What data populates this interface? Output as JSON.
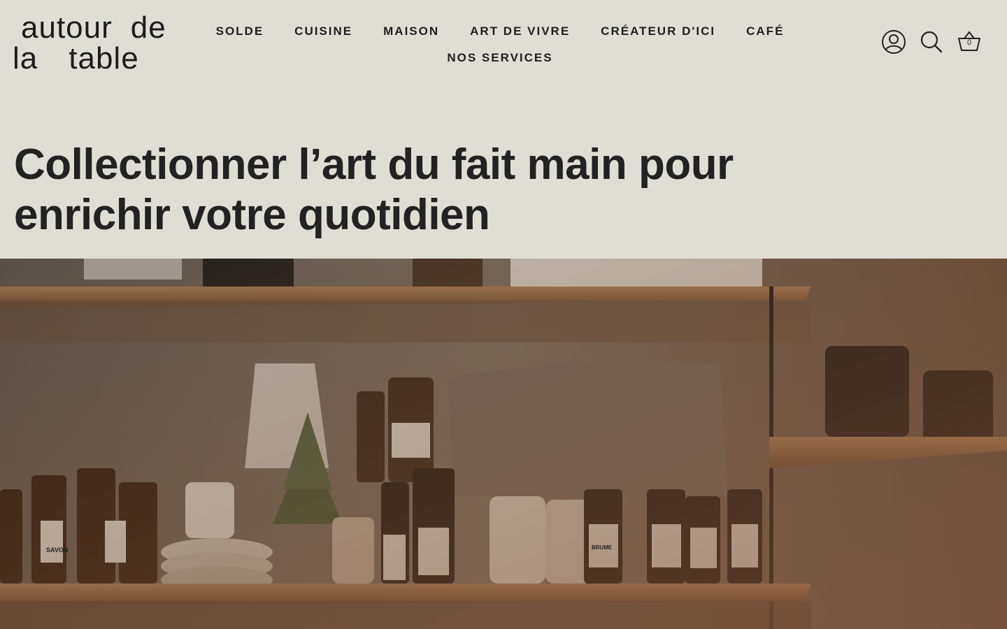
{
  "brand": {
    "line1_word1": "autour",
    "line1_word2": "de",
    "line2_word1": "la",
    "line2_word2": "table"
  },
  "nav": {
    "row1": [
      "SOLDE",
      "CUISINE",
      "MAISON",
      "ART DE VIVRE",
      "CRÉATEUR D'ICI",
      "CAFÉ"
    ],
    "row2": [
      "NOS SERVICES"
    ]
  },
  "header_icons": {
    "account": "account-icon",
    "search": "search-icon",
    "cart": "basket-icon",
    "cart_count": "0"
  },
  "hero": {
    "title_line1": "Collectionner l’art du fait main pour",
    "title_line2": "enrichir votre quotidien",
    "image_labels": {
      "savon": "SAVON",
      "brume": "BRUME"
    }
  },
  "colors": {
    "background": "#dfded5",
    "text": "#222222"
  }
}
